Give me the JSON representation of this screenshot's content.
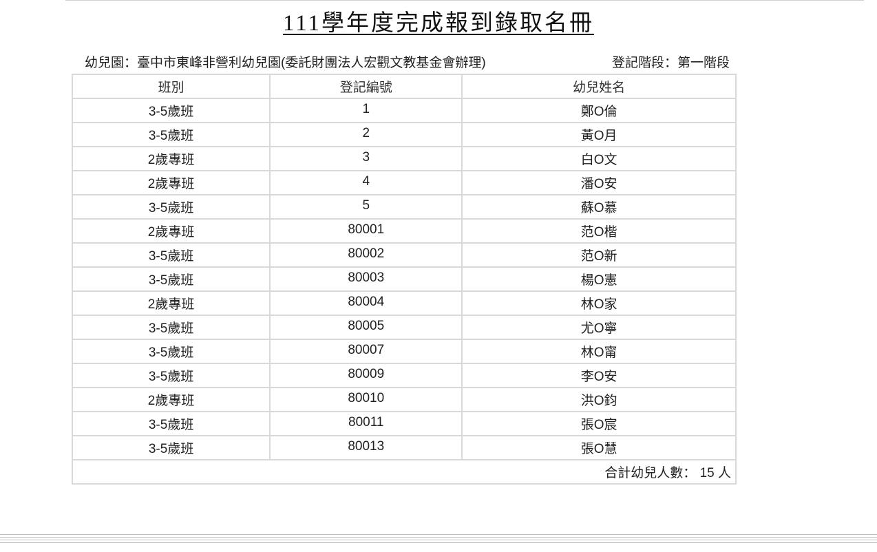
{
  "title": "111學年度完成報到錄取名冊",
  "kindergarten_label": "幼兒園：臺中市東峰非營利幼兒園(委託財團法人宏觀文教基金會辦理)",
  "stage_label": "登記階段：第一階段",
  "table": {
    "headers": [
      "班別",
      "登記編號",
      "幼兒姓名"
    ],
    "rows": [
      {
        "class": "3-5歲班",
        "code": "1",
        "name": "鄭O倫"
      },
      {
        "class": "3-5歲班",
        "code": "2",
        "name": "黃O月"
      },
      {
        "class": "2歲專班",
        "code": "3",
        "name": "白O文"
      },
      {
        "class": "2歲專班",
        "code": "4",
        "name": "潘O安"
      },
      {
        "class": "3-5歲班",
        "code": "5",
        "name": "蘇O慕"
      },
      {
        "class": "2歲專班",
        "code": "80001",
        "name": "范O楷"
      },
      {
        "class": "3-5歲班",
        "code": "80002",
        "name": "范O新"
      },
      {
        "class": "3-5歲班",
        "code": "80003",
        "name": "楊O憲"
      },
      {
        "class": "2歲專班",
        "code": "80004",
        "name": "林O家"
      },
      {
        "class": "3-5歲班",
        "code": "80005",
        "name": "尤O寧"
      },
      {
        "class": "3-5歲班",
        "code": "80007",
        "name": "林O甯"
      },
      {
        "class": "3-5歲班",
        "code": "80009",
        "name": "李O安"
      },
      {
        "class": "2歲專班",
        "code": "80010",
        "name": "洪O鈞"
      },
      {
        "class": "3-5歲班",
        "code": "80011",
        "name": "張O宸"
      },
      {
        "class": "3-5歲班",
        "code": "80013",
        "name": "張O慧"
      }
    ],
    "total_label": "合計幼兒人數： 15 人"
  }
}
